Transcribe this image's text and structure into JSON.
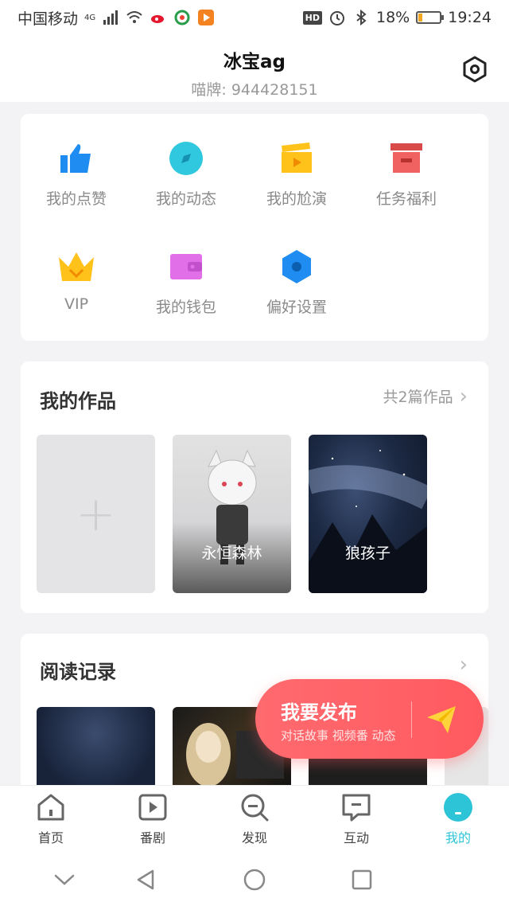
{
  "status_bar": {
    "carrier": "中国移动",
    "network": "4G",
    "battery": "18%",
    "time": "19:24"
  },
  "header": {
    "username": "冰宝ag",
    "user_id": "喵牌: 944428151"
  },
  "menu": {
    "items": [
      {
        "label": "我的点赞",
        "icon": "thumbs-up-icon",
        "color": "#1e8cf0"
      },
      {
        "label": "我的动态",
        "icon": "compass-icon",
        "color": "#2fc8de"
      },
      {
        "label": "我的尬演",
        "icon": "clapperboard-icon",
        "color": "#ffc21a"
      },
      {
        "label": "任务福利",
        "icon": "gift-box-icon",
        "color": "#f06262"
      },
      {
        "label": "VIP",
        "icon": "crown-icon",
        "color": "#ffc21a"
      },
      {
        "label": "我的钱包",
        "icon": "wallet-icon",
        "color": "#e170e8"
      },
      {
        "label": "偏好设置",
        "icon": "hexagon-settings-icon",
        "color": "#1e8cf0"
      }
    ]
  },
  "works": {
    "title": "我的作品",
    "more_label": "共2篇作品",
    "items": [
      {
        "title": "永恒森林"
      },
      {
        "title": "狼孩子"
      }
    ]
  },
  "history": {
    "title": "阅读记录"
  },
  "publish": {
    "title": "我要发布",
    "subtitle": "对话故事 视频番 动态"
  },
  "tabs": [
    {
      "label": "首页",
      "icon": "home-icon",
      "active": false
    },
    {
      "label": "番剧",
      "icon": "play-icon",
      "active": false
    },
    {
      "label": "发现",
      "icon": "discover-search-icon",
      "active": false
    },
    {
      "label": "互动",
      "icon": "chat-icon",
      "active": false
    },
    {
      "label": "我的",
      "icon": "profile-icon",
      "active": true
    }
  ],
  "colors": {
    "accent": "#2ec4d8",
    "publish": "#ff5f64"
  }
}
